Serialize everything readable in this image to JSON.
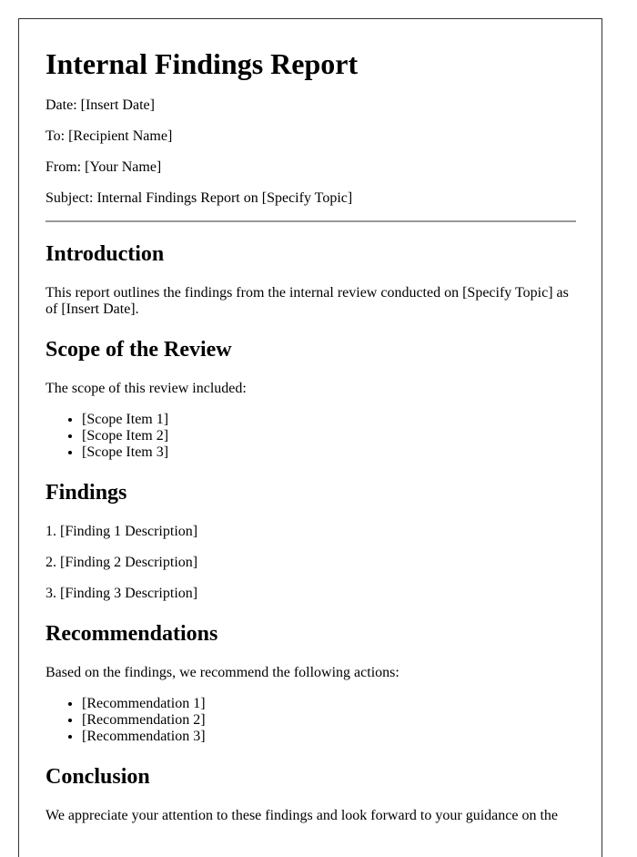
{
  "document": {
    "title": "Internal Findings Report",
    "meta": {
      "date": "Date: [Insert Date]",
      "to": "To: [Recipient Name]",
      "from": "From: [Your Name]",
      "subject": "Subject: Internal Findings Report on [Specify Topic]"
    },
    "sections": {
      "introduction": {
        "heading": "Introduction",
        "text": "This report outlines the findings from the internal review conducted on [Specify Topic] as of [Insert Date]."
      },
      "scope": {
        "heading": "Scope of the Review",
        "intro": "The scope of this review included:",
        "items": [
          "[Scope Item 1]",
          "[Scope Item 2]",
          "[Scope Item 3]"
        ]
      },
      "findings": {
        "heading": "Findings",
        "items": [
          "1. [Finding 1 Description]",
          "2. [Finding 2 Description]",
          "3. [Finding 3 Description]"
        ]
      },
      "recommendations": {
        "heading": "Recommendations",
        "intro": "Based on the findings, we recommend the following actions:",
        "items": [
          "[Recommendation 1]",
          "[Recommendation 2]",
          "[Recommendation 3]"
        ]
      },
      "conclusion": {
        "heading": "Conclusion",
        "text": "We appreciate your attention to these findings and look forward to your guidance on the"
      }
    }
  }
}
